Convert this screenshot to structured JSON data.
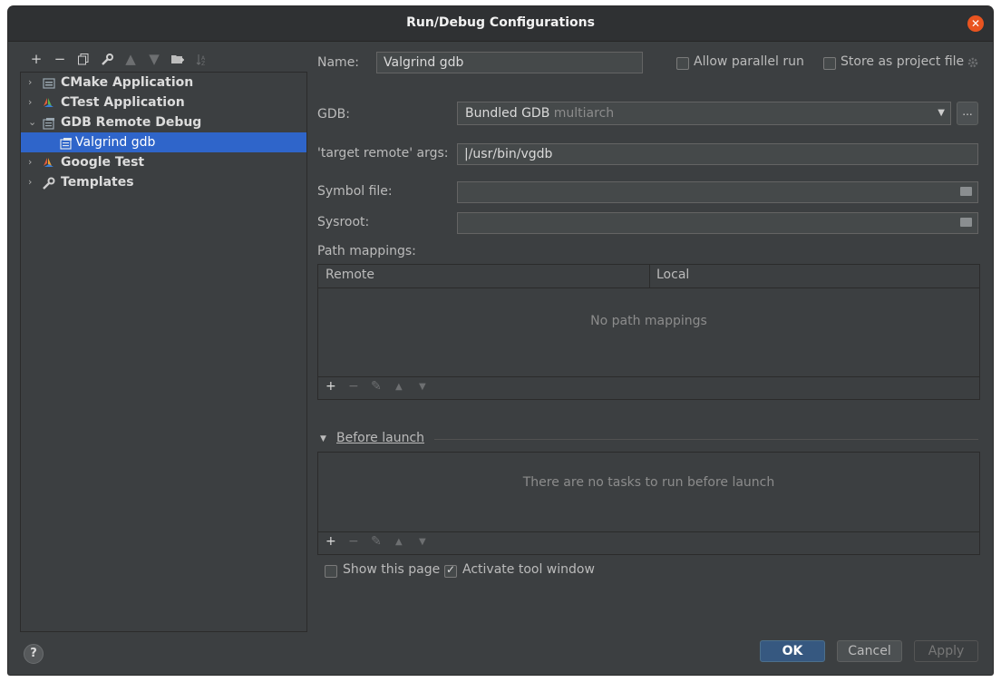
{
  "window": {
    "title": "Run/Debug Configurations"
  },
  "toolbar": {
    "icons": [
      "plus-icon",
      "minus-icon",
      "copy-icon",
      "wrench-icon",
      "arrow-up-icon",
      "arrow-down-icon",
      "folder-add-icon",
      "sort-icon"
    ]
  },
  "tree": {
    "items": [
      {
        "label": "CMake Application",
        "expanded": false
      },
      {
        "label": "CTest Application",
        "expanded": false
      },
      {
        "label": "GDB Remote Debug",
        "expanded": true
      },
      {
        "label": "Valgrind gdb",
        "selected": true
      },
      {
        "label": "Google Test",
        "expanded": false
      },
      {
        "label": "Templates",
        "expanded": false
      }
    ]
  },
  "form": {
    "name_label": "Name:",
    "name_value": "Valgrind gdb",
    "allow_parallel_label": "Allow parallel run",
    "store_as_project_label": "Store as project file",
    "gdb_label": "GDB:",
    "gdb_value": "Bundled GDB",
    "gdb_value_suffix": "multiarch",
    "gdb_more": "...",
    "target_remote_label": "'target remote' args:",
    "target_remote_value": "|/usr/bin/vgdb",
    "symbol_file_label": "Symbol file:",
    "sysroot_label": "Sysroot:",
    "path_mappings_label": "Path mappings:",
    "col_remote": "Remote",
    "col_local": "Local",
    "no_mappings": "No path mappings",
    "before_launch_label": "Before launch",
    "no_tasks": "There are no tasks to run before launch",
    "show_page_label": "Show this page",
    "activate_tool_label": "Activate tool window"
  },
  "buttons": {
    "ok": "OK",
    "cancel": "Cancel",
    "apply": "Apply",
    "help": "?"
  },
  "colors": {
    "selection": "#2f65ca",
    "close": "#e95420",
    "primary": "#365880"
  }
}
